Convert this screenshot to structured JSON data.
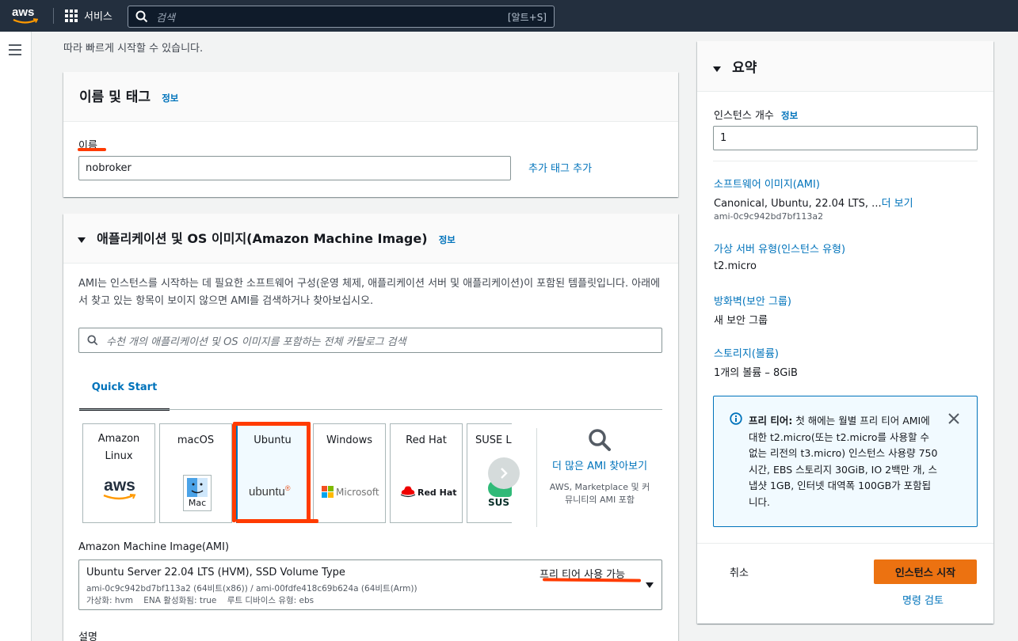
{
  "topnav": {
    "logo_text": "aws",
    "services_label": "서비스",
    "search_placeholder": "검색",
    "search_shortcut": "[알트+S]"
  },
  "intro_text": "따라 빠르게 시작할 수 있습니다.",
  "name_tags": {
    "title": "이름 및 태그",
    "info": "정보",
    "name_label": "이름",
    "name_value": "nobroker",
    "add_tag": "추가 태그 추가"
  },
  "ami_section": {
    "title": "애플리케이션 및 OS 이미지(Amazon Machine Image)",
    "info": "정보",
    "description": "AMI는 인스턴스를 시작하는 데 필요한 소프트웨어 구성(운영 체제, 애플리케이션 서버 및 애플리케이션)이 포함된 템플릿입니다. 아래에서 찾고 있는 항목이 보이지 않으면 AMI를 검색하거나 찾아보십시오.",
    "search_placeholder": "수천 개의 애플리케이션 및 OS 이미지를 포함하는 전체 카탈로그 검색",
    "tab_quick_start": "Quick Start",
    "os_cards": [
      {
        "label": "Amazon Linux",
        "logo": "aws"
      },
      {
        "label": "macOS",
        "logo": "Mac"
      },
      {
        "label": "Ubuntu",
        "logo": "ubuntu"
      },
      {
        "label": "Windows",
        "logo": "Microsoft"
      },
      {
        "label": "Red Hat",
        "logo": "Red Hat"
      },
      {
        "label": "SUSE Li",
        "logo": "SUS"
      }
    ],
    "browse_more": "더 많은 AMI 찾아보기",
    "browse_sub": "AWS, Marketplace 및 커뮤니티의 AMI 포함",
    "ami_label": "Amazon Machine Image(AMI)",
    "ami_name": "Ubuntu Server 22.04 LTS (HVM), SSD Volume Type",
    "ami_ids": "ami-0c9c942bd7bf113a2 (64비트(x86)) / ami-00fdfe418c69b624a (64비트(Arm))",
    "ami_meta": "가상화: hvm    ENA 활성화됨: true    루트 디바이스 유형: ebs",
    "free_tier": "프리 티어 사용 가능",
    "desc_label": "설명"
  },
  "summary": {
    "title": "요약",
    "instance_count_label": "인스턴스 개수",
    "info": "정보",
    "instance_count": "1",
    "software_image_label": "소프트웨어 이미지(AMI)",
    "software_image_value": "Canonical, Ubuntu, 22.04 LTS, ...",
    "more": "더 보기",
    "software_image_id": "ami-0c9c942bd7bf113a2",
    "instance_type_label": "가상 서버 유형(인스턴스 유형)",
    "instance_type_value": "t2.micro",
    "firewall_label": "방화벽(보안 그룹)",
    "firewall_value": "새 보안 그룹",
    "storage_label": "스토리지(볼륨)",
    "storage_value": "1개의 볼륨 – 8GiB",
    "free_tier_title": "프리 티어:",
    "free_tier_text": " 첫 해에는 월별 프리 티어 AMI에 대한 t2.micro(또는 t2.micro를 사용할 수 없는 리전의 t3.micro) 인스턴스 사용량 750시간, EBS 스토리지 30GiB, IO 2백만 개, 스냅샷 1GB, 인터넷 대역폭 100GB가 포함됩니다.",
    "cancel": "취소",
    "launch": "인스턴스 시작",
    "review_commands": "명령 검토"
  },
  "colors": {
    "nav_bg": "#232f3e",
    "link": "#0073bb",
    "launch_button": "#ec7211",
    "annotation_red": "#ff3b00",
    "info_box_bg": "#f1faff",
    "info_box_border": "#0073bb"
  }
}
